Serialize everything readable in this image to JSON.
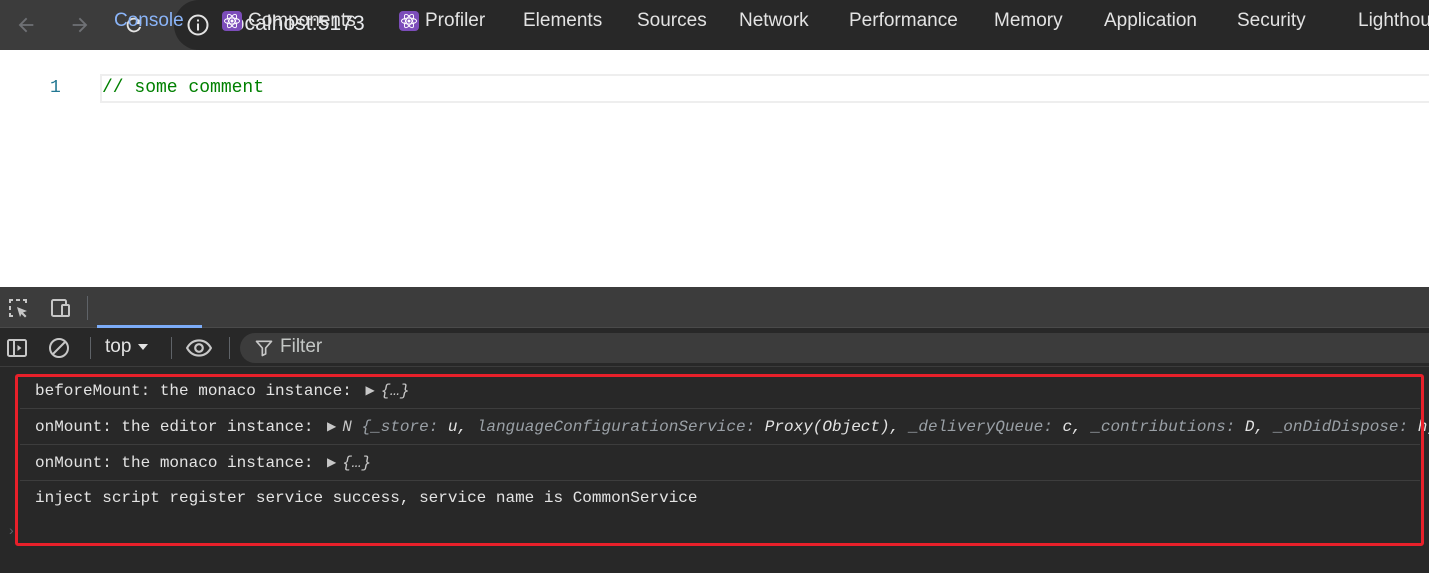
{
  "browser": {
    "back_label": "Back",
    "forward_label": "Forward",
    "reload_label": "Reload",
    "url": "localhost:5173"
  },
  "editor": {
    "line_number": "1",
    "line_text": "// some comment"
  },
  "devtools": {
    "tabs": [
      {
        "label": "Console",
        "active": true
      },
      {
        "label": "Components",
        "icon": "react-icon"
      },
      {
        "label": "Profiler",
        "icon": "react-icon"
      },
      {
        "label": "Elements"
      },
      {
        "label": "Sources"
      },
      {
        "label": "Network"
      },
      {
        "label": "Performance"
      },
      {
        "label": "Memory"
      },
      {
        "label": "Application"
      },
      {
        "label": "Security"
      },
      {
        "label": "Lighthou"
      }
    ],
    "console_toolbar": {
      "context": "top",
      "filter_placeholder": "Filter"
    },
    "messages": [
      {
        "text": "beforeMount: the monaco instance: ",
        "object": "{…}"
      },
      {
        "text": "onMount: the editor instance: ",
        "prefix": "N",
        "object_parts": {
          "open": "{",
          "k1": "_store",
          "v1": "u",
          "k2": "languageConfigurationService",
          "v2": "Proxy(Object)",
          "k3": "_deliveryQueue",
          "v3": "c",
          "k4": "_contributions",
          "v4": "D",
          "k5": "_onDidDispose",
          "v5": "h",
          "close": "…}"
        }
      },
      {
        "text": "onMount: the monaco instance: ",
        "object": "{…}"
      },
      {
        "text": "inject script register service success, service name is CommonService"
      }
    ],
    "highlight_color": "#e8202a",
    "accent_color": "#8ab4f8"
  }
}
